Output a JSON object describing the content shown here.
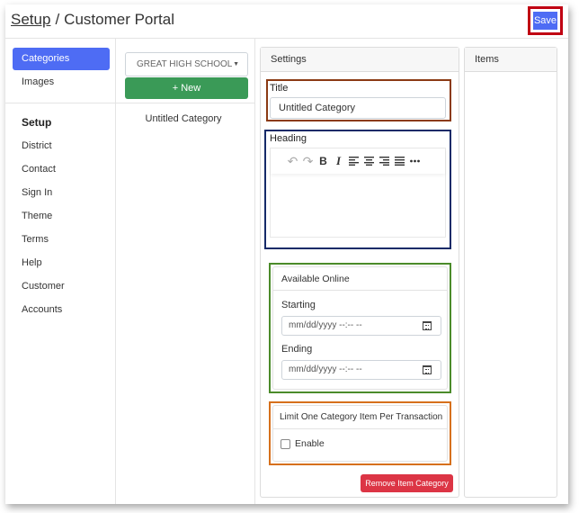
{
  "header": {
    "breadcrumb_link": "Setup",
    "separator": "/",
    "title": "Customer Portal",
    "save_label": "Save"
  },
  "sidebar": {
    "top_items": [
      {
        "label": "Categories",
        "active": true
      },
      {
        "label": "Images",
        "active": false
      }
    ],
    "section_heading": "Setup",
    "items": [
      {
        "label": "District"
      },
      {
        "label": "Contact"
      },
      {
        "label": "Sign In"
      },
      {
        "label": "Theme"
      },
      {
        "label": "Terms"
      },
      {
        "label": "Help"
      },
      {
        "label": "Customer Accounts"
      }
    ]
  },
  "categories": {
    "school_select": "GREAT HIGH SCHOOL",
    "new_label": "+ New",
    "items": [
      "Untitled Category"
    ]
  },
  "settings": {
    "header": "Settings",
    "title_label": "Title",
    "title_value": "Untitled Category",
    "heading_label": "Heading",
    "available_header": "Available Online",
    "starting_label": "Starting",
    "starting_placeholder": "mm/dd/yyyy --:-- --",
    "ending_label": "Ending",
    "ending_placeholder": "mm/dd/yyyy --:-- --",
    "limit_header": "Limit One Category Item Per Transaction",
    "enable_label": "Enable",
    "remove_label": "Remove Item Category"
  },
  "items_panel": {
    "header": "Items"
  },
  "colors": {
    "primary": "#4e6cf4",
    "success": "#3a9a57",
    "danger": "#dc3545",
    "highlight_title": "#8b3a14",
    "highlight_heading": "#152a68",
    "highlight_available": "#4b8b2a",
    "highlight_limit": "#d6701c",
    "highlight_save": "#c00012"
  }
}
